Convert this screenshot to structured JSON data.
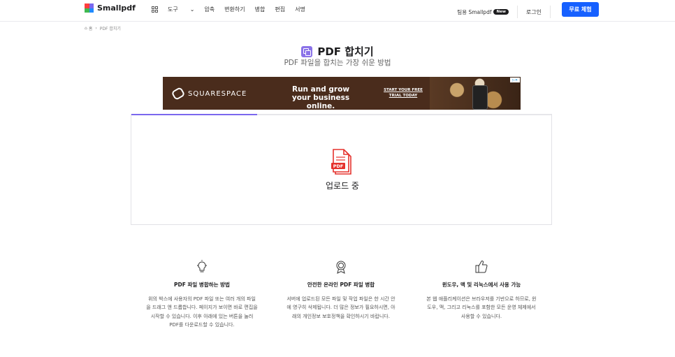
{
  "nav": {
    "logo_text": "Smallpdf",
    "menu": [
      "도구",
      "압축",
      "변환하기",
      "병합",
      "편집",
      "서명"
    ],
    "team_label": "팀용 Smallpdf",
    "new_badge": "New",
    "login": "로그인",
    "cta": "무료 체험"
  },
  "breadcrumb": {
    "home": "홈",
    "sep": "›",
    "current": "PDF 합치기"
  },
  "header": {
    "title": "PDF 합치기",
    "subtitle": "PDF 파일을 합치는 가장 쉬운 방법"
  },
  "ad": {
    "brand": "SQUARESPACE",
    "headline": "Run and grow your business online.",
    "link": "START YOUR FREE TRIAL TODAY"
  },
  "upload": {
    "status": "업로드 중",
    "progress": 0.3,
    "icon_text": "PDF"
  },
  "features": [
    {
      "icon": "lightbulb-icon",
      "title": "PDF 파일 병합하는 방법",
      "text": "위의 박스에 사용자의 PDF 파일 또는 여러 개의 파일을 드래그 앤 드롭합니다. 페이지가 보이면 바로 편집을 시작할 수 있습니다. 이후 아래에 있는 버튼을 눌러 PDF를 다운로드할 수 있습니다."
    },
    {
      "icon": "award-icon",
      "title": "안전한 온라인 PDF 파일 병합",
      "text": "서버에 업로드된 모든 파일 및 작업 파일은 한 시간 안에 영구히 삭제됩니다. 더 많은 정보가 필요하시면, 아래의 개인정보 보호정책을 확인하시기 바랍니다."
    },
    {
      "icon": "thumbs-up-icon",
      "title": "윈도우, 맥 및 리눅스에서 사용 가능",
      "text": "본 웹 애플리케이션은 브라우저를 기반으로 하므로, 윈도우, 맥, 그리고 리눅스를 포함한 모든 운영 체제에서 사용할 수 있습니다."
    }
  ]
}
